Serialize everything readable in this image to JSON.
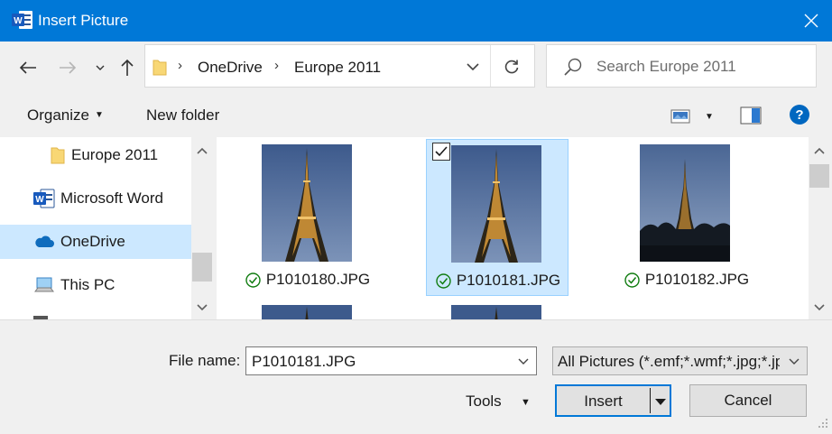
{
  "window": {
    "title": "Insert Picture",
    "app_icon": "word-icon"
  },
  "address": {
    "breadcrumbs": [
      "OneDrive",
      "Europe 2011"
    ],
    "search_placeholder": "Search Europe 2011"
  },
  "toolbar": {
    "organize_label": "Organize",
    "new_folder_label": "New folder",
    "help_label": "?"
  },
  "nav_pane": {
    "items": [
      {
        "label": "Europe 2011",
        "icon": "folder-icon",
        "selected": false
      },
      {
        "label": "Microsoft Word",
        "icon": "word-icon",
        "selected": false
      },
      {
        "label": "OneDrive",
        "icon": "cloud-icon",
        "selected": true
      },
      {
        "label": "This PC",
        "icon": "computer-icon",
        "selected": false
      }
    ]
  },
  "files": [
    {
      "name": "P1010180.JPG",
      "selected": false,
      "sync_status": "synced"
    },
    {
      "name": "P1010181.JPG",
      "selected": true,
      "sync_status": "synced"
    },
    {
      "name": "P1010182.JPG",
      "selected": false,
      "sync_status": "synced"
    }
  ],
  "bottom": {
    "file_name_label": "File name:",
    "file_name_value": "P1010181.JPG",
    "file_type_value": "All Pictures (*.emf;*.wmf;*.jpg;*.jpeg;*.jfif;*.jpe;*.png;*.bmp;*.dib;*.rle;*.gif;*.emz;*.wmz;*.tif;*.tiff;*.svg;*.ico)",
    "tools_label": "Tools",
    "insert_label": "Insert",
    "cancel_label": "Cancel"
  },
  "colors": {
    "accent": "#0078d7",
    "selection": "#cce8ff",
    "sync_ok": "#107c10",
    "folder": "#f8d775"
  }
}
